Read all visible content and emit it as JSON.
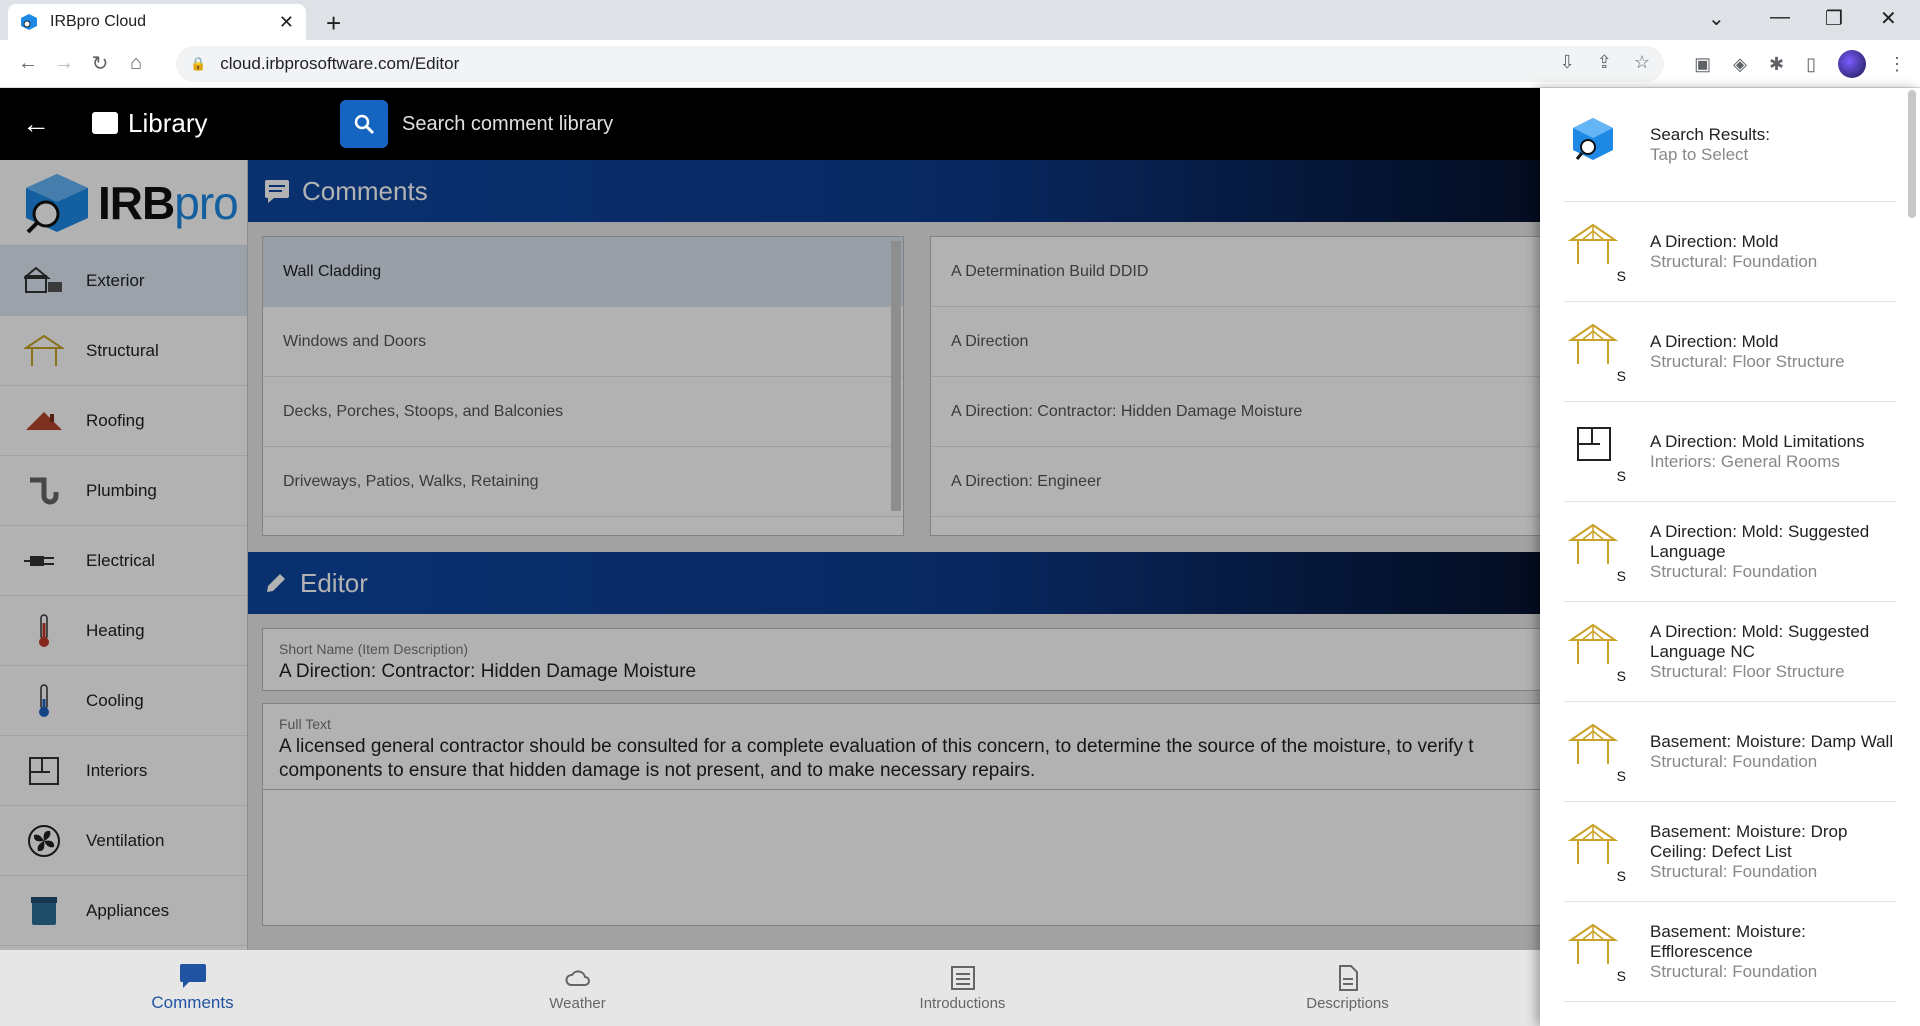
{
  "browser": {
    "tab_title": "IRBpro Cloud",
    "url": "cloud.irbprosoftware.com/Editor"
  },
  "appbar": {
    "title": "Library",
    "search_placeholder": "Search comment library"
  },
  "logo": {
    "text_main": "IRB",
    "text_pro": "pro"
  },
  "sidebar": {
    "items": [
      {
        "label": "Exterior",
        "icon": "house-icon",
        "active": true
      },
      {
        "label": "Structural",
        "icon": "roof-truss-icon"
      },
      {
        "label": "Roofing",
        "icon": "roof-icon"
      },
      {
        "label": "Plumbing",
        "icon": "pipe-icon"
      },
      {
        "label": "Electrical",
        "icon": "plug-icon"
      },
      {
        "label": "Heating",
        "icon": "thermometer-hot-icon"
      },
      {
        "label": "Cooling",
        "icon": "thermometer-cold-icon"
      },
      {
        "label": "Interiors",
        "icon": "floorplan-icon"
      },
      {
        "label": "Ventilation",
        "icon": "fan-icon"
      },
      {
        "label": "Appliances",
        "icon": "appliance-icon"
      }
    ]
  },
  "comments": {
    "header": "Comments",
    "left_list": [
      "Wall Cladding",
      "Windows and Doors",
      "Decks, Porches, Stoops, and Balconies",
      "Driveways, Patios, Walks, Retaining"
    ],
    "right_list": [
      "A Determination Build DDID",
      "A Direction",
      "A Direction: Contractor: Hidden Damage Moisture",
      "A Direction: Engineer"
    ]
  },
  "editor": {
    "header": "Editor",
    "short_name_label": "Short Name (Item Description)",
    "short_name_value": "A Direction: Contractor: Hidden Damage Moisture",
    "full_text_label": "Full Text",
    "full_text_value": "A licensed general contractor should be consulted for a complete evaluation of this concern, to determine the source of the moisture, to verify t components to ensure that hidden damage is not present, and to make necessary repairs."
  },
  "bottom_nav": [
    {
      "label": "Comments",
      "active": true
    },
    {
      "label": "Weather"
    },
    {
      "label": "Introductions"
    },
    {
      "label": "Descriptions"
    }
  ],
  "drawer": {
    "header_title": "Search Results:",
    "header_sub": "Tap to Select",
    "results": [
      {
        "title": "A Direction: Mold",
        "sub": "Structural: Foundation",
        "type": "structural",
        "badge": "S"
      },
      {
        "title": "A Direction: Mold",
        "sub": "Structural: Floor Structure",
        "type": "structural",
        "badge": "S"
      },
      {
        "title": "A Direction: Mold Limitations",
        "sub": "Interiors: General Rooms",
        "type": "interiors",
        "badge": "S"
      },
      {
        "title": "A Direction: Mold: Suggested Language",
        "sub": "Structural: Foundation",
        "type": "structural",
        "badge": "S"
      },
      {
        "title": "A Direction: Mold: Suggested Language NC",
        "sub": "Structural: Floor Structure",
        "type": "structural",
        "badge": "S"
      },
      {
        "title": "Basement: Moisture: Damp Wall",
        "sub": "Structural: Foundation",
        "type": "structural",
        "badge": "S"
      },
      {
        "title": "Basement: Moisture: Drop Ceiling: Defect List",
        "sub": "Structural: Foundation",
        "type": "structural",
        "badge": "S"
      },
      {
        "title": "Basement: Moisture: Efflorescence",
        "sub": "Structural: Foundation",
        "type": "structural",
        "badge": "S"
      }
    ]
  },
  "colors": {
    "accent": "#1565c0",
    "structural_icon": "#c9a227"
  }
}
